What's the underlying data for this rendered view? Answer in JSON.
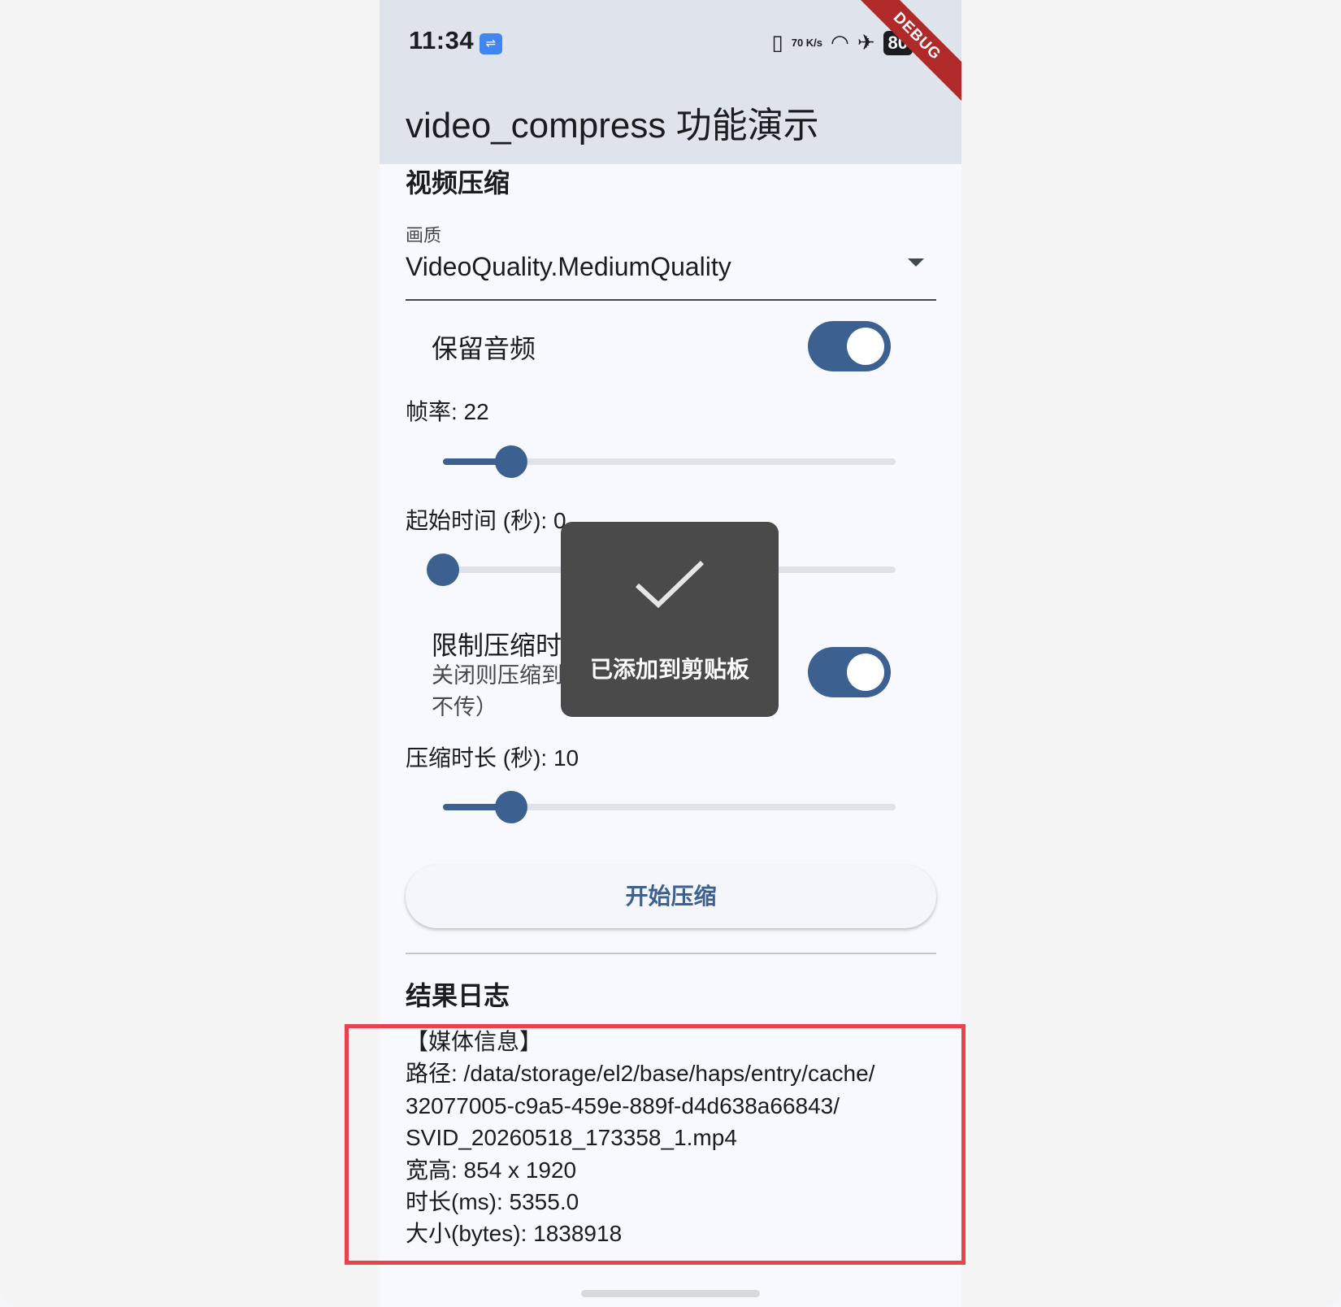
{
  "status_bar": {
    "time": "11:34",
    "network_speed": "70 K/s",
    "battery": "80",
    "debug_ribbon": "DEBUG",
    "icons": [
      "usb-icon",
      "vibrate-icon",
      "wifi-icon",
      "airplane-icon",
      "battery-icon"
    ]
  },
  "app_bar": {
    "title": "video_compress 功能演示"
  },
  "section": {
    "title": "视频压缩"
  },
  "quality": {
    "label": "画质",
    "value": "VideoQuality.MediumQuality"
  },
  "keep_audio": {
    "label": "保留音频",
    "on": true
  },
  "frame_rate": {
    "label": "帧率: 22",
    "fraction": 0.15
  },
  "start_time": {
    "label": "起始时间 (秒): 0",
    "fraction": 0.0
  },
  "limit_duration": {
    "label": "限制压缩时",
    "subtitle_line1": "关闭则压缩到",
    "subtitle_line2": "不传）",
    "on": true
  },
  "duration": {
    "label": "压缩时长 (秒): 10",
    "fraction": 0.15
  },
  "start_button": {
    "label": "开始压缩"
  },
  "log": {
    "title": "结果日志",
    "lines": [
      "【媒体信息】",
      "路径: /data/storage/el2/base/haps/entry/cache/",
      "32077005-c9a5-459e-889f-d4d638a66843/",
      "SVID_20260518_173358_1.mp4",
      "宽高: 854 x 1920",
      "时长(ms): 5355.0",
      "大小(bytes): 1838918"
    ]
  },
  "toast": {
    "message": "已添加到剪贴板",
    "icon": "check-icon"
  },
  "colors": {
    "accent": "#3c608f",
    "app_bar": "#dee3ec",
    "highlight": "#e8434b",
    "toast": "#4a4a4a"
  }
}
